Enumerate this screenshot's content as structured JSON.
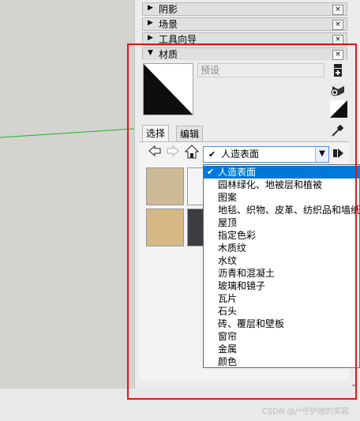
{
  "sections": [
    {
      "label": "阴影",
      "expanded": false
    },
    {
      "label": "场景",
      "expanded": false
    },
    {
      "label": "工具向导",
      "expanded": false
    },
    {
      "label": "材质",
      "expanded": true
    }
  ],
  "close_glyph": "×",
  "materials": {
    "preset_placeholder": "预设",
    "tabs": [
      "选择",
      "编辑"
    ],
    "active_tab": "选择",
    "collection_selected": "人造表面",
    "collections": [
      "人造表面",
      "园林绿化、地被层和植被",
      "图案",
      "地毯、织物、皮革、纺织品和墙纸",
      "屋顶",
      "指定色彩",
      "木质纹",
      "水纹",
      "沥青和混凝土",
      "玻璃和镜子",
      "瓦片",
      "石头",
      "砖、覆层和壁板",
      "窗帘",
      "金属",
      "颜色"
    ],
    "thumbnails": [
      {
        "color": "#cdb995"
      },
      {
        "color": "#f4f4f4"
      },
      {
        "color": "#d6b886"
      },
      {
        "color": "#3b3d42"
      }
    ]
  },
  "colors": {
    "accent": "#0078d7",
    "frame": "#e3161b"
  },
  "watermark": "CSDN @/*守护她的笑容"
}
